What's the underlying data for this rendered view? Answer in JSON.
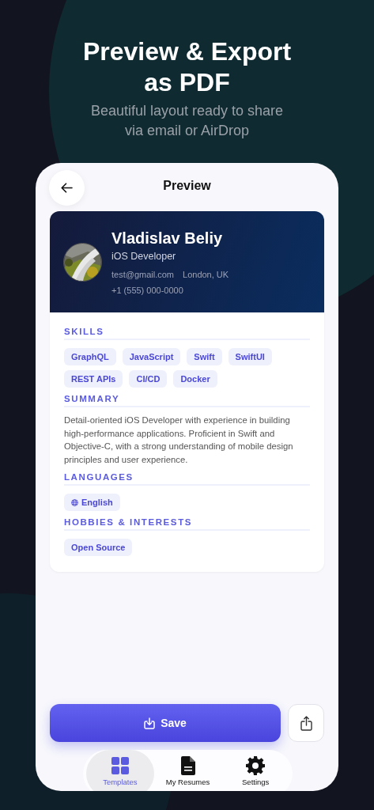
{
  "hero": {
    "title": "Preview & Export as PDF",
    "subtitle": "Beautiful layout ready to share via email or AirDrop"
  },
  "screen": {
    "title": "Preview"
  },
  "resume": {
    "name": "Vladislav Beliy",
    "role": "iOS Developer",
    "email": "test@gmail.com",
    "location": "London, UK",
    "phone": "+1 (555) 000-0000",
    "sections": [
      {
        "kind": "chips",
        "title": "SKILLS",
        "items": [
          "GraphQL",
          "JavaScript",
          "Swift",
          "SwiftUI",
          "REST APIs",
          "CI/CD",
          "Docker"
        ]
      },
      {
        "kind": "text",
        "title": "SUMMARY",
        "text": "Detail-oriented iOS Developer with experience in building high-performance applications. Proficient in Swift and Objective-C, with a strong understanding of mobile design principles and user experience."
      },
      {
        "kind": "languages",
        "title": "LANGUAGES",
        "items": [
          "English"
        ]
      },
      {
        "kind": "chips",
        "title": "HOBBIES & INTERESTS",
        "items": [
          "Open Source"
        ]
      }
    ]
  },
  "actions": {
    "save": "Save"
  },
  "tabs": [
    {
      "label": "Templates",
      "selected": true
    },
    {
      "label": "My Resumes",
      "selected": false
    },
    {
      "label": "Settings",
      "selected": false
    }
  ]
}
